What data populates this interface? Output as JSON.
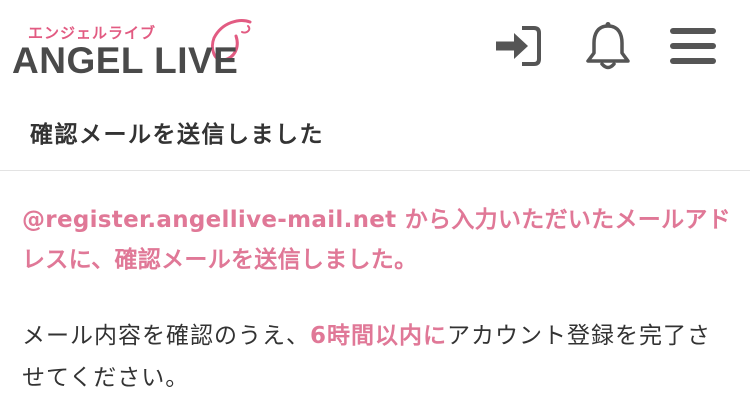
{
  "header": {
    "logo_kana": "エンジェルライブ",
    "logo_text": "ANGEL LIVE",
    "icons": {
      "login": "login-icon",
      "bell": "bell-icon",
      "menu": "hamburger-menu-icon"
    }
  },
  "page": {
    "title": "確認メールを送信しました"
  },
  "message": {
    "notice": "@register.angellive-mail.net から入力いただいたメールアドレスに、確認メールを送信しました。",
    "body_before": "メール内容を確認のうえ、",
    "body_highlight": "6時間以内に",
    "body_after": "アカウント登録を完了させてください。"
  },
  "colors": {
    "accent": "#e07897",
    "icon": "#555555",
    "logo_gray": "#4a4a4a"
  }
}
